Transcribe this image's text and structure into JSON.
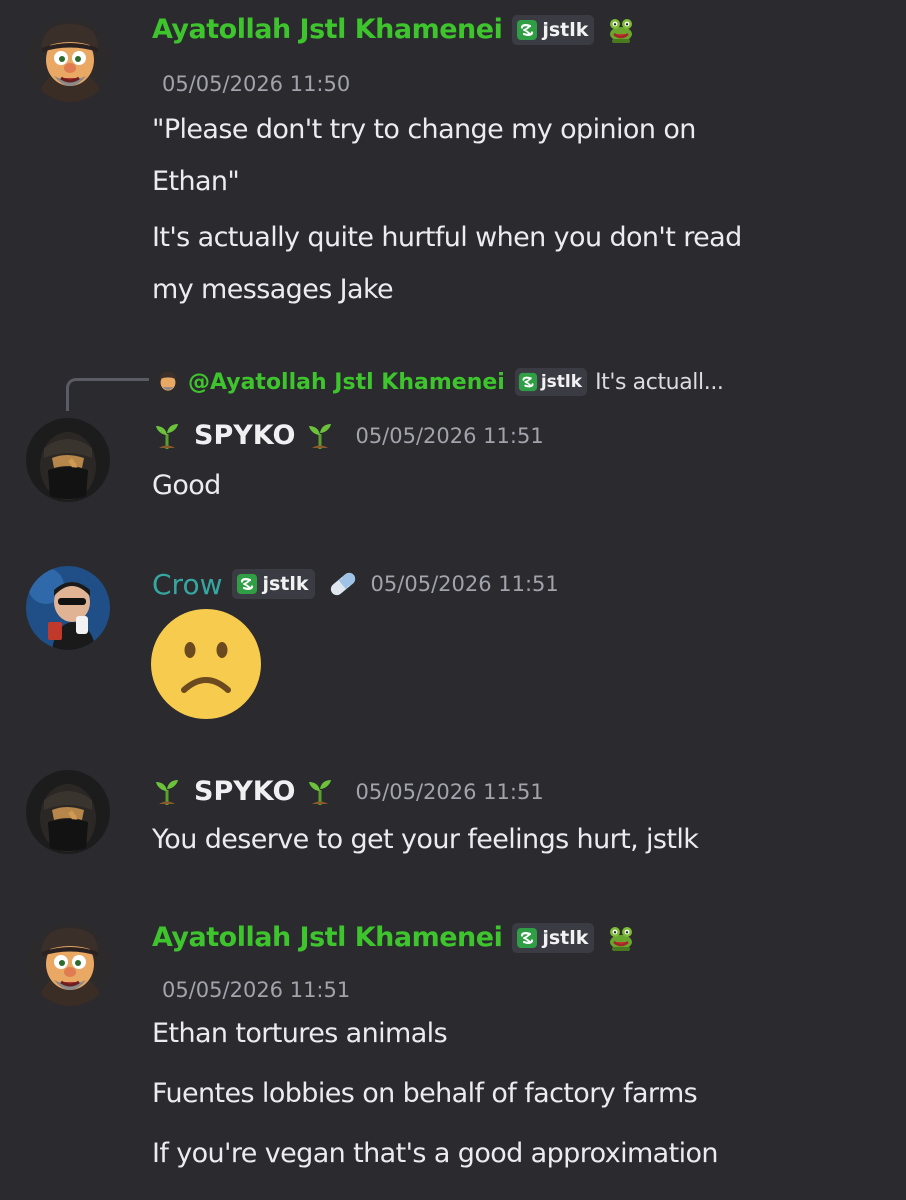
{
  "messages": [
    {
      "author": "Ayatollah Jstl Khamenei",
      "tag": "jstlk",
      "role_icon": "frog-icon",
      "timestamp": "05/05/2026 11:50",
      "lines": [
        "\"Please don't try to change my opinion on",
        "Ethan\"",
        "It's actually quite hurtful when you don't read",
        "my messages Jake"
      ]
    },
    {
      "reply_to": {
        "author": "@Ayatollah Jstl Khamenei",
        "tag": "jstlk",
        "snippet": "It's actuall..."
      },
      "author": "SPYKO",
      "timestamp": "05/05/2026 11:51",
      "lines": [
        "Good"
      ]
    },
    {
      "author": "Crow",
      "tag": "jstlk",
      "role_icon": "pill-icon",
      "timestamp": "05/05/2026 11:51",
      "content_emoji": "frowning-face"
    },
    {
      "author": "SPYKO",
      "timestamp": "05/05/2026 11:51",
      "lines": [
        "You deserve to get your feelings hurt, jstlk"
      ]
    },
    {
      "author": "Ayatollah Jstl Khamenei",
      "tag": "jstlk",
      "role_icon": "frog-icon",
      "timestamp": "05/05/2026 11:51",
      "lines": [
        "Ethan tortures animals",
        "Fuentes lobbies on behalf of factory farms",
        "If you're vegan that's a good approximation"
      ]
    }
  ],
  "colors": {
    "background": "#2a2a2f",
    "name_green": "#3ec42c",
    "name_teal": "#35a6a0",
    "timestamp": "#a2a3ab",
    "tag_bg": "#3b3c43"
  }
}
